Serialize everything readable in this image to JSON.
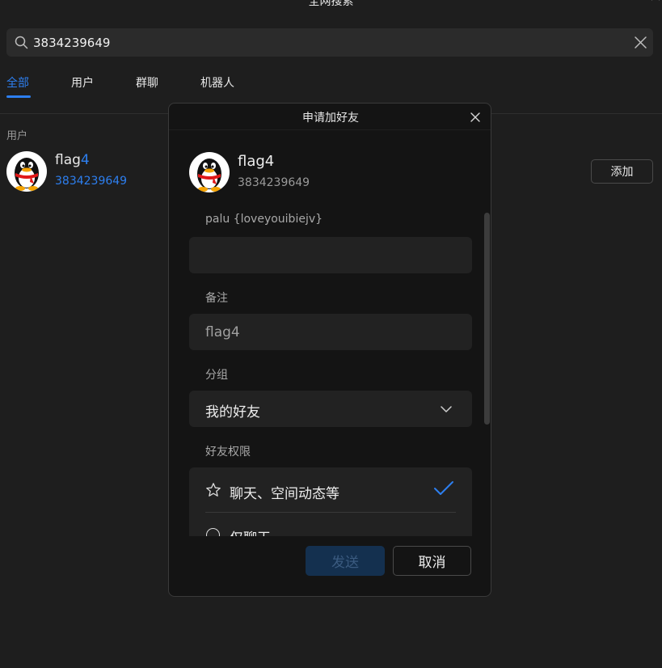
{
  "window": {
    "title": "全网搜索",
    "min_icon": "minimize-icon",
    "max_icon": "maximize-icon",
    "close_icon": "close-icon"
  },
  "search": {
    "value": "3834239649",
    "icon": "search-icon",
    "clear_icon": "clear-icon"
  },
  "tabs": [
    {
      "label": "全部",
      "active": true
    },
    {
      "label": "用户",
      "active": false
    },
    {
      "label": "群聊",
      "active": false
    },
    {
      "label": "机器人",
      "active": false
    }
  ],
  "results": {
    "section_label": "用户",
    "user": {
      "name_prefix": "flag",
      "name_highlight": "4",
      "id": "3834239649",
      "add_label": "添加"
    }
  },
  "dialog": {
    "title": "申请加好友",
    "user_name": "flag4",
    "user_id": "3834239649",
    "question_label": "palu  {loveyouibiejv}",
    "answer_value": "",
    "remark_label": "备注",
    "remark_value": "flag4",
    "group_label": "分组",
    "group_value": "我的好友",
    "permission_label": "好友权限",
    "permission_options": [
      {
        "label": "聊天、空间动态等",
        "selected": true
      },
      {
        "label": "仅聊天",
        "selected": false
      }
    ],
    "send_label": "发送",
    "cancel_label": "取消"
  },
  "colors": {
    "accent": "#2d7ff0",
    "background": "#1e1e1e",
    "dialog_bg": "#141414",
    "field_bg": "#222222"
  }
}
